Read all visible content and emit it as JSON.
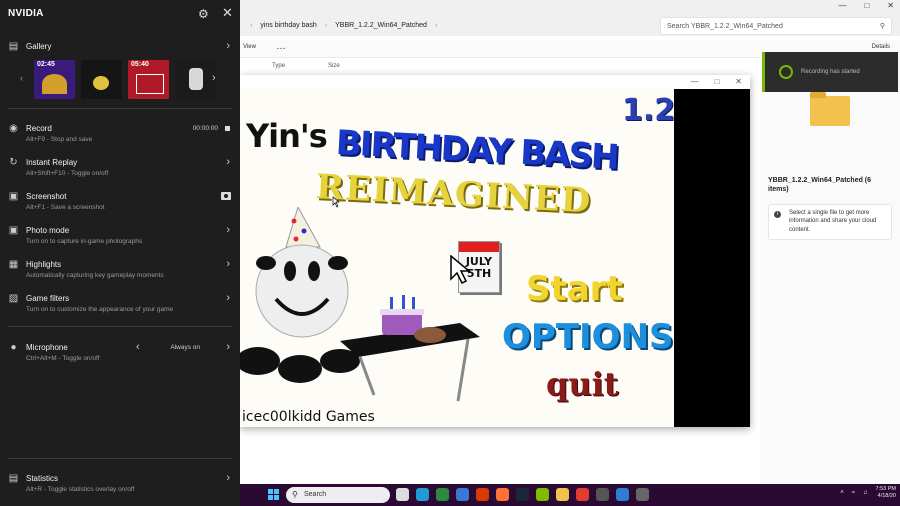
{
  "explorer": {
    "tabs": [
      "yins birthday bash",
      "YBBR_1.2.2_Win64_Patched"
    ],
    "search_placeholder": "Search YBBR_1.2.2_Win64_Patched",
    "toolbar": {
      "view_label": "View",
      "more_label": "…",
      "details_label": "Details"
    },
    "columns": [
      "Type",
      "Size"
    ],
    "notification": "Recording has started",
    "details_title": "YBBR_1.2.2_Win64_Patched (6 items)",
    "details_info": "Select a single file to get more information and share your cloud content."
  },
  "game": {
    "version": "1.2",
    "title_prefix": "Yin's",
    "title_main": "BIRTHDAY BASH",
    "title_sub": "REIMAGINED",
    "calendar_text": "JULY 5TH",
    "menu": [
      "Start",
      "OPTIONS",
      "quit"
    ],
    "studio": "icec00lkidd Games"
  },
  "overlay": {
    "title": "NVIDIA",
    "gallery": {
      "label": "Gallery",
      "thumbs": [
        "02:45",
        "",
        "05:40",
        ""
      ]
    },
    "items": [
      {
        "label": "Record",
        "sub": "Alt+F9 - Stop and save",
        "value": "00:00:00"
      },
      {
        "label": "Instant Replay",
        "sub": "Alt+Shift+F10 - Toggle on/off"
      },
      {
        "label": "Screenshot",
        "sub": "Alt+F1 - Save a screenshot"
      },
      {
        "label": "Photo mode",
        "sub": "Turn on to capture in-game photographs"
      },
      {
        "label": "Highlights",
        "sub": "Automatically capturing key gameplay moments"
      },
      {
        "label": "Game filters",
        "sub": "Turn on to customize the appearance of your game"
      },
      {
        "label": "Microphone",
        "sub": "Ctrl+Alt+M - Toggle on/off",
        "value": "Always on"
      },
      {
        "label": "Statistics",
        "sub": "Alt+R - Toggle statistics overlay on/off"
      }
    ]
  },
  "taskbar": {
    "search": "Search",
    "time": "7:53 PM",
    "date": "4/18/20"
  },
  "colors": {
    "nvidia_green": "#76b900",
    "overlay_bg": "#1e1e1e",
    "taskbar_bg": "#2a0a32"
  }
}
